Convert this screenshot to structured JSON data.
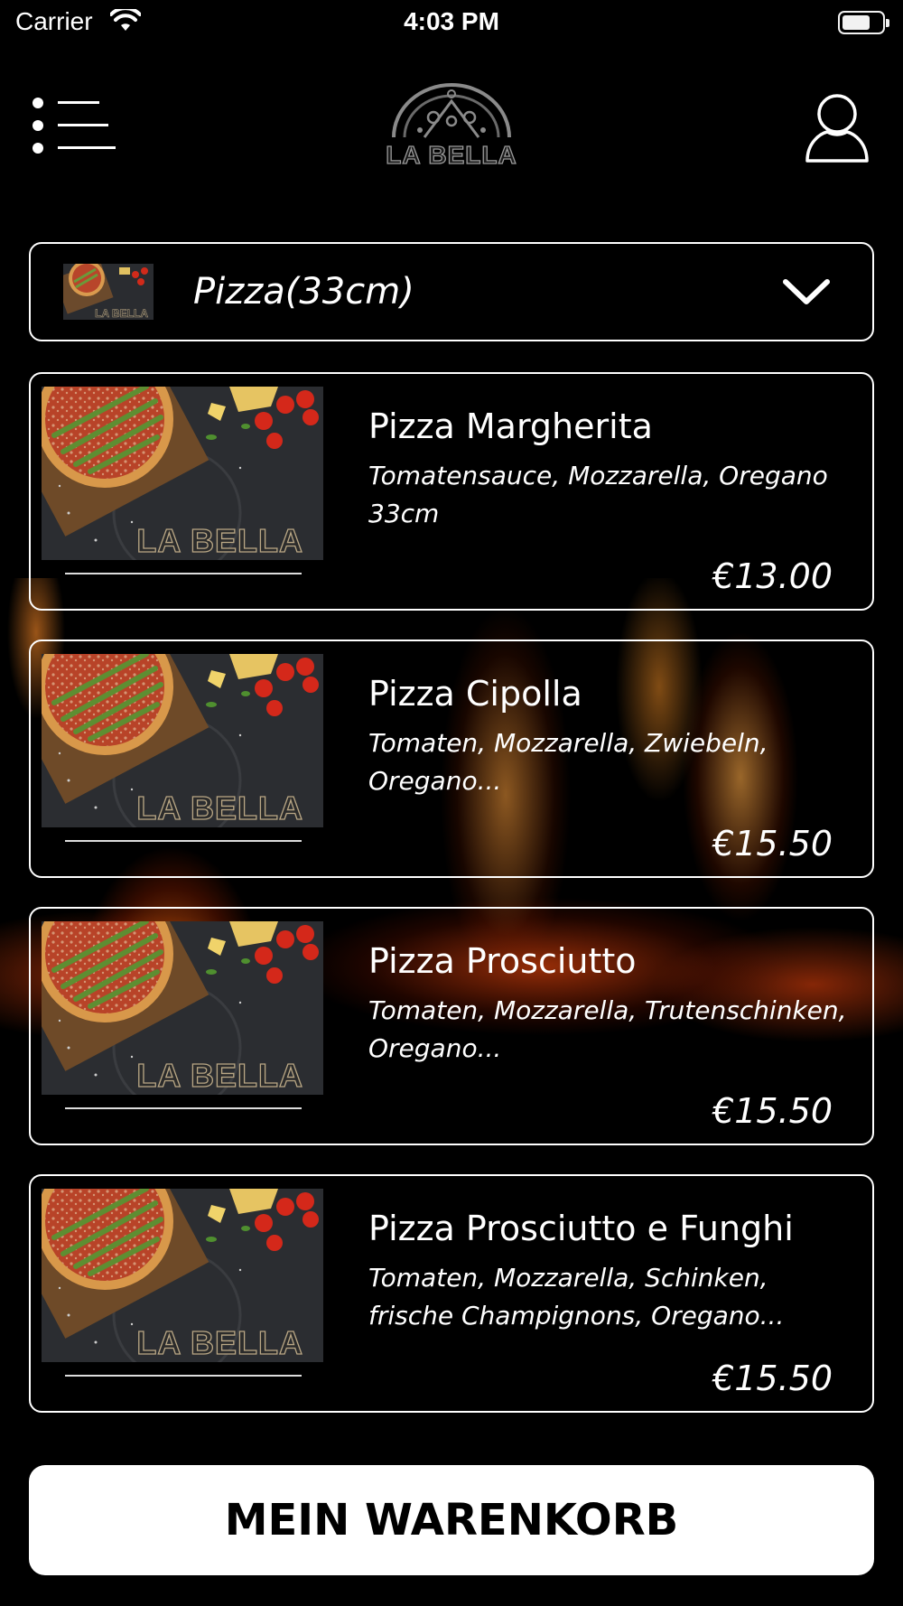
{
  "status_bar": {
    "carrier": "Carrier",
    "time": "4:03 PM"
  },
  "header": {
    "logo_text": "LA BELLA",
    "menu_icon": "list-menu-icon",
    "profile_icon": "user-profile-icon"
  },
  "category": {
    "selected": "Pizza(33cm)",
    "thumb_brand": "LA BELLA",
    "dropdown_icon": "chevron-down-icon"
  },
  "products": [
    {
      "name": "Pizza Margherita",
      "description": "Tomatensauce, Mozzarella, Oregano 33cm",
      "price": "€13.00",
      "thumb_brand": "LA BELLA"
    },
    {
      "name": "Pizza Cipolla",
      "description": "Tomaten, Mozzarella, Zwiebeln, Oregano...",
      "price": "€15.50",
      "thumb_brand": "LA BELLA"
    },
    {
      "name": "Pizza Prosciutto",
      "description": "Tomaten, Mozzarella, Trutenschinken, Oregano...",
      "price": "€15.50",
      "thumb_brand": "LA BELLA"
    },
    {
      "name": "Pizza Prosciutto e Funghi",
      "description": "Tomaten, Mozzarella, Schinken, frische Champignons, Oregano...",
      "price": "€15.50",
      "thumb_brand": "LA BELLA"
    }
  ],
  "cart": {
    "label": "MEIN WARENKORB"
  },
  "colors": {
    "background": "#000000",
    "text": "#ffffff",
    "cart_button_bg": "#ffffff",
    "cart_button_text": "#000000"
  }
}
